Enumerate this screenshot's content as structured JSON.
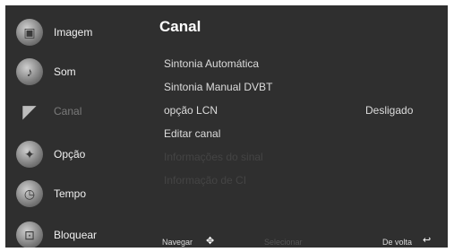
{
  "sidebar": {
    "items": [
      {
        "label": "Imagem",
        "icon": "image-icon",
        "glyph": "▣"
      },
      {
        "label": "Som",
        "icon": "speaker-icon",
        "glyph": "♪"
      },
      {
        "label": "Canal",
        "icon": "satellite-dish-icon",
        "glyph": "◤"
      },
      {
        "label": "Opção",
        "icon": "option-icon",
        "glyph": "✦"
      },
      {
        "label": "Tempo",
        "icon": "clock-icon",
        "glyph": "◷"
      },
      {
        "label": "Bloquear",
        "icon": "lock-icon",
        "glyph": "⊡"
      }
    ]
  },
  "panel": {
    "title": "Canal",
    "items": [
      {
        "label": "Sintonia Automática"
      },
      {
        "label": "Sintonia Manual DVBT"
      },
      {
        "label": "opção LCN",
        "value": "Desligado"
      },
      {
        "label": "Editar canal"
      },
      {
        "label": "Informações do sinal"
      },
      {
        "label": "Informação de CI"
      }
    ]
  },
  "footer": {
    "navigate_label": "Navegar",
    "navigate_icon": "arrows-icon",
    "select_label": "Selecionar",
    "back_label": "De volta",
    "back_icon": "return-arrow-icon"
  },
  "colors": {
    "background": "#2f2f2f",
    "text": "#dcdcdc",
    "active_item": "#7a7a7a",
    "disabled_item": "#444444"
  }
}
